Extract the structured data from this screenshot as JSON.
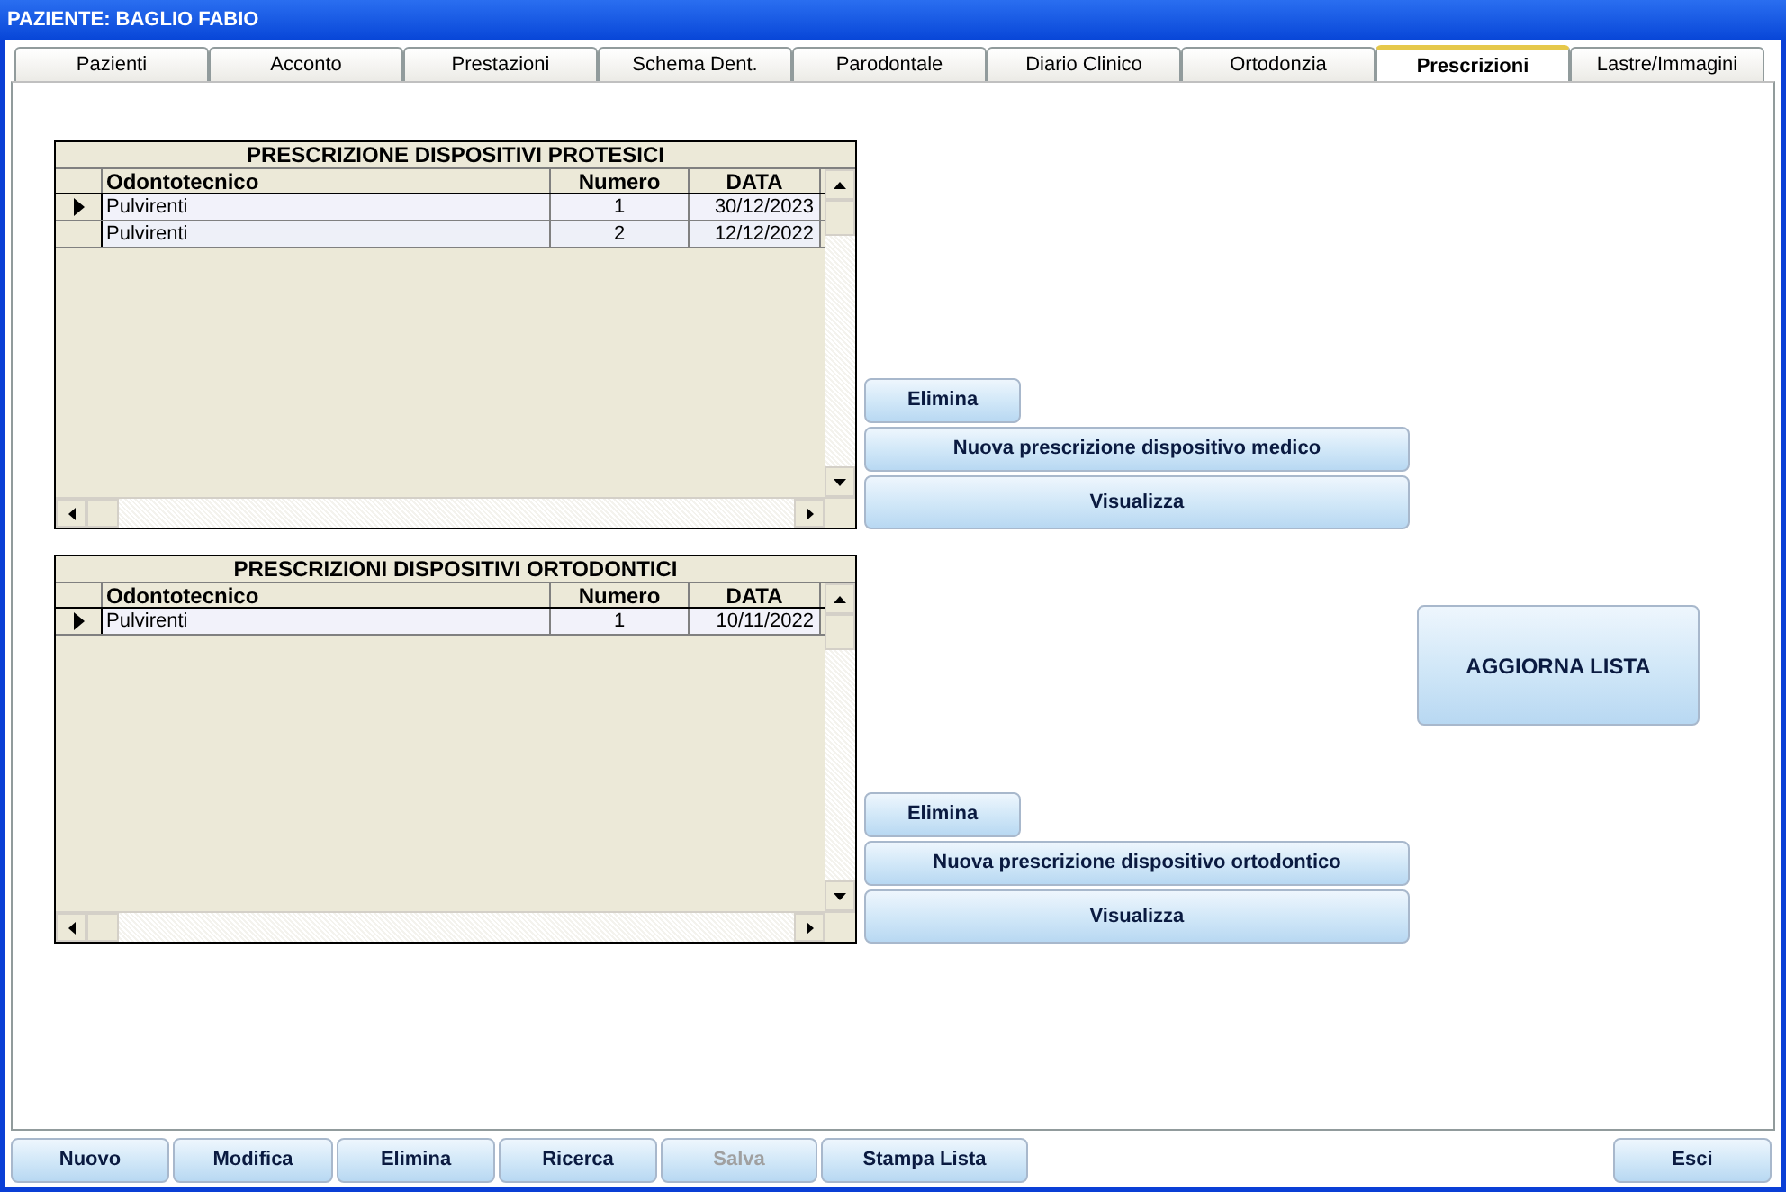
{
  "window": {
    "title": "PAZIENTE: BAGLIO FABIO"
  },
  "tabs": [
    {
      "label": "Pazienti",
      "selected": false
    },
    {
      "label": "Acconto",
      "selected": false
    },
    {
      "label": "Prestazioni",
      "selected": false
    },
    {
      "label": "Schema Dent.",
      "selected": false
    },
    {
      "label": "Parodontale",
      "selected": false
    },
    {
      "label": "Diario Clinico",
      "selected": false
    },
    {
      "label": "Ortodonzia",
      "selected": false
    },
    {
      "label": "Prescrizioni",
      "selected": true
    },
    {
      "label": "Lastre/Immagini",
      "selected": false
    }
  ],
  "sections": [
    {
      "table": {
        "title": "PRESCRIZIONE DISPOSITIVI PROTESICI",
        "columns": [
          "Odontotecnico",
          "Numero",
          "DATA"
        ],
        "rows": [
          {
            "cells": [
              "Pulvirenti",
              "1",
              "30/12/2023"
            ],
            "selected": true
          },
          {
            "cells": [
              "Pulvirenti",
              "2",
              "12/12/2022"
            ],
            "selected": false
          }
        ]
      },
      "buttons": [
        "Elimina",
        "Nuova prescrizione dispositivo medico",
        "Visualizza"
      ]
    },
    {
      "table": {
        "title": "PRESCRIZIONI DISPOSITIVI ORTODONTICI",
        "columns": [
          "Odontotecnico",
          "Numero",
          "DATA"
        ],
        "rows": [
          {
            "cells": [
              "Pulvirenti",
              "1",
              "10/11/2022"
            ],
            "selected": true
          }
        ]
      },
      "buttons": [
        "Elimina",
        "Nuova prescrizione dispositivo ortodontico",
        "Visualizza"
      ]
    }
  ],
  "refresh_button": "AGGIORNA LISTA",
  "toolbar": [
    {
      "label": "Nuovo",
      "disabled": false
    },
    {
      "label": "Modifica",
      "disabled": false
    },
    {
      "label": "Elimina",
      "disabled": false
    },
    {
      "label": "Ricerca",
      "disabled": false
    },
    {
      "label": "Salva",
      "disabled": true
    },
    {
      "label": "Stampa Lista",
      "disabled": false
    }
  ],
  "exit_button": "Esci"
}
